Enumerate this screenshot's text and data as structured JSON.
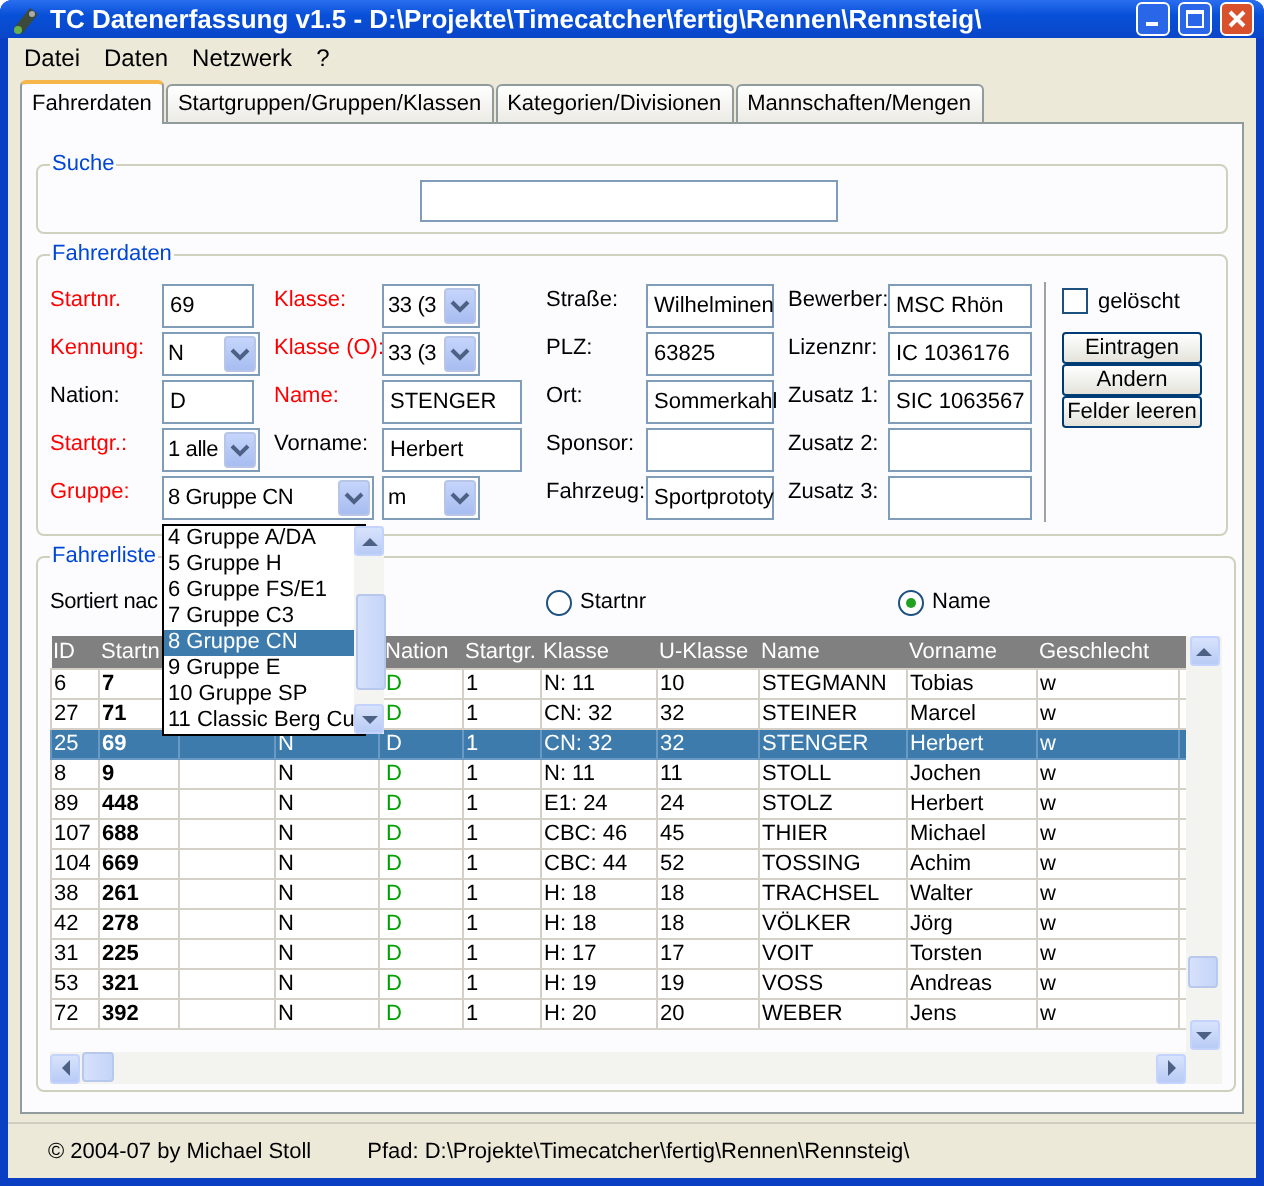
{
  "window": {
    "title": "TC Datenerfassung v1.5 - D:\\Projekte\\Timecatcher\\fertig\\Rennen\\Rennsteig\\"
  },
  "menu": [
    "Datei",
    "Daten",
    "Netzwerk",
    "?"
  ],
  "tabs": [
    {
      "label": "Fahrerdaten",
      "selected": true
    },
    {
      "label": "Startgruppen/Gruppen/Klassen",
      "selected": false
    },
    {
      "label": "Kategorien/Divisionen",
      "selected": false
    },
    {
      "label": "Mannschaften/Mengen",
      "selected": false
    }
  ],
  "search": {
    "title": "Suche"
  },
  "driver_form": {
    "title": "Fahrerdaten",
    "rows": [
      [
        {
          "label": "Startnr.",
          "value": "69",
          "kind": "text",
          "required": true
        },
        {
          "label": "Klasse:",
          "value": "33 (3",
          "kind": "select",
          "required": true
        },
        {
          "label": "Straße:",
          "value": "Wilhelminen",
          "kind": "text",
          "required": false
        },
        {
          "label": "Bewerber:",
          "value": "MSC Rhön",
          "kind": "text",
          "required": false
        }
      ],
      [
        {
          "label": "Kennung:",
          "value": "N",
          "kind": "select",
          "required": true
        },
        {
          "label": "Klasse (O):",
          "value": "33 (3",
          "kind": "select",
          "required": true
        },
        {
          "label": "PLZ:",
          "value": "63825",
          "kind": "text",
          "required": false
        },
        {
          "label": "Lizenznr:",
          "value": "IC 1036176",
          "kind": "text",
          "required": false
        }
      ],
      [
        {
          "label": "Nation:",
          "value": "D",
          "kind": "text",
          "required": false
        },
        {
          "label": "Name:",
          "value": "STENGER",
          "kind": "text",
          "required": true
        },
        {
          "label": "Ort:",
          "value": "Sommerkahl",
          "kind": "text",
          "required": false
        },
        {
          "label": "Zusatz 1:",
          "value": "SIC 1063567",
          "kind": "text",
          "required": false
        }
      ],
      [
        {
          "label": "Startgr.:",
          "value": "1 alle",
          "kind": "select",
          "required": true
        },
        {
          "label": "Vorname:",
          "value": "Herbert",
          "kind": "text",
          "required": false
        },
        {
          "label": "Sponsor:",
          "kind": "text",
          "required": false
        },
        {
          "label": "Zusatz 2:",
          "kind": "text",
          "required": false
        }
      ],
      [
        {
          "label": "Gruppe:",
          "value": "8 Gruppe CN",
          "kind": "select",
          "required": true,
          "wide": true,
          "open": true
        },
        {
          "value": "m",
          "kind": "select"
        },
        {
          "label": "Fahrzeug:",
          "value": "Sportprototy",
          "kind": "text",
          "required": false
        },
        {
          "label": "Zusatz 3:",
          "kind": "text",
          "required": false
        }
      ]
    ],
    "dropdown_items": [
      {
        "label": "4 Gruppe A/DA",
        "selected": false
      },
      {
        "label": "5 Gruppe H",
        "selected": false
      },
      {
        "label": "6 Gruppe FS/E1",
        "selected": false
      },
      {
        "label": "7 Gruppe C3",
        "selected": false
      },
      {
        "label": "8 Gruppe CN",
        "selected": true
      },
      {
        "label": "9 Gruppe E",
        "selected": false
      },
      {
        "label": "10 Gruppe SP",
        "selected": false
      },
      {
        "label": "11 Classic Berg Cu",
        "selected": false
      }
    ],
    "deleted": {
      "label": "gelöscht",
      "checked": false
    },
    "buttons": [
      "Eintragen",
      "Andern",
      "Felder leeren"
    ]
  },
  "driver_list": {
    "title": "Fahrerliste",
    "sort_label": "Sortiert nac",
    "sort_options": [
      {
        "label": "Startnr",
        "selected": false
      },
      {
        "label": "Name",
        "selected": true
      }
    ],
    "columns": [
      "ID",
      "Startn",
      null,
      null,
      "Nation",
      "Startgr.",
      "Klasse",
      "U-Klasse",
      "Name",
      "Vorname",
      "Geschlecht"
    ],
    "rows": [
      {
        "cells": [
          "6",
          "7",
          null,
          null,
          "D",
          "1",
          "N: 11",
          "10",
          "STEGMANN",
          "Tobias",
          "w"
        ],
        "selected": false
      },
      {
        "cells": [
          "27",
          "71",
          null,
          null,
          "D",
          "1",
          "CN: 32",
          "32",
          "STEINER",
          "Marcel",
          "w"
        ],
        "selected": false
      },
      {
        "cells": [
          "25",
          "69",
          null,
          "N",
          "D",
          "1",
          "CN: 32",
          "32",
          "STENGER",
          "Herbert",
          "w"
        ],
        "selected": true
      },
      {
        "cells": [
          "8",
          "9",
          null,
          "N",
          "D",
          "1",
          "N: 11",
          "11",
          "STOLL",
          "Jochen",
          "w"
        ],
        "selected": false
      },
      {
        "cells": [
          "89",
          "448",
          null,
          "N",
          "D",
          "1",
          "E1: 24",
          "24",
          "STOLZ",
          "Herbert",
          "w"
        ],
        "selected": false
      },
      {
        "cells": [
          "107",
          "688",
          null,
          "N",
          "D",
          "1",
          "CBC: 46",
          "45",
          "THIER",
          "Michael",
          "w"
        ],
        "selected": false
      },
      {
        "cells": [
          "104",
          "669",
          null,
          "N",
          "D",
          "1",
          "CBC: 44",
          "52",
          "TOSSING",
          "Achim",
          "w"
        ],
        "selected": false
      },
      {
        "cells": [
          "38",
          "261",
          null,
          "N",
          "D",
          "1",
          "H: 18",
          "18",
          "TRACHSEL",
          "Walter",
          "w"
        ],
        "selected": false
      },
      {
        "cells": [
          "42",
          "278",
          null,
          "N",
          "D",
          "1",
          "H: 18",
          "18",
          "VÖLKER",
          "Jörg",
          "w"
        ],
        "selected": false
      },
      {
        "cells": [
          "31",
          "225",
          null,
          "N",
          "D",
          "1",
          "H: 17",
          "17",
          "VOIT",
          "Torsten",
          "w"
        ],
        "selected": false
      },
      {
        "cells": [
          "53",
          "321",
          null,
          "N",
          "D",
          "1",
          "H: 19",
          "19",
          "VOSS",
          "Andreas",
          "w"
        ],
        "selected": false
      },
      {
        "cells": [
          "72",
          "392",
          null,
          "N",
          "D",
          "1",
          "H: 20",
          "20",
          "WEBER",
          "Jens",
          "w"
        ],
        "selected": false
      }
    ]
  },
  "status_bar": {
    "copyright": "© 2004-07 by Michael Stoll",
    "path": "Pfad: D:\\Projekte\\Timecatcher\\fertig\\Rennen\\Rennsteig\\"
  }
}
